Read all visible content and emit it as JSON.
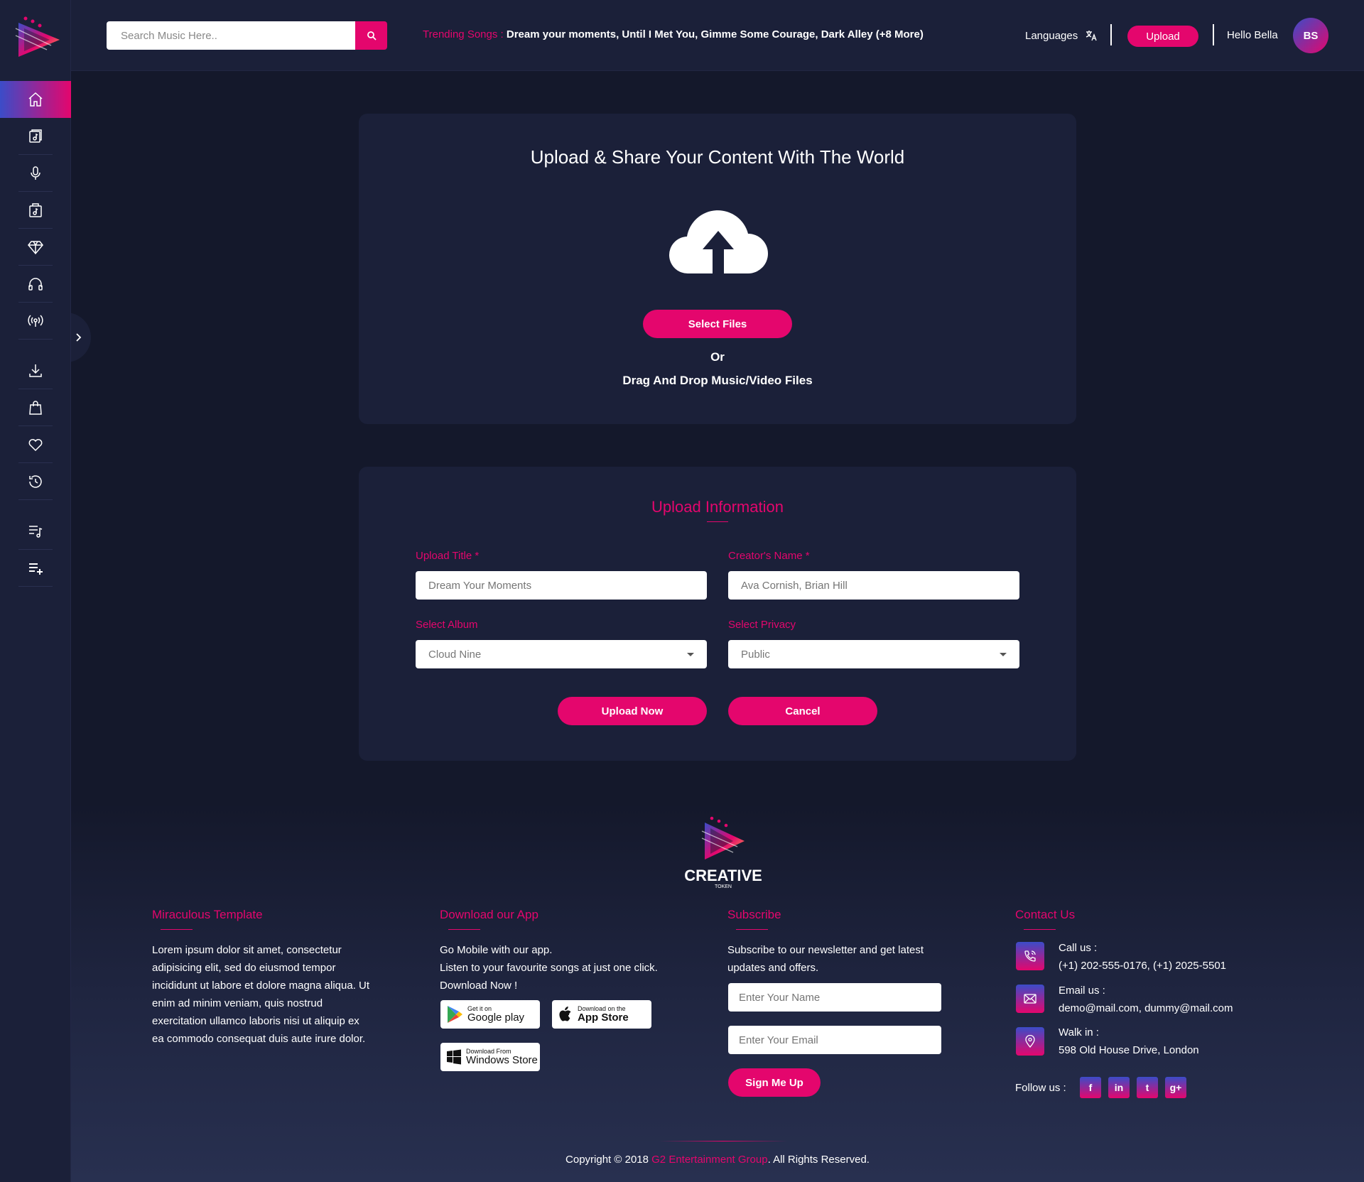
{
  "header": {
    "search_placeholder": "Search Music Here..",
    "trending_label": "Trending Songs :",
    "trending_songs": "Dream your moments, Until I Met You, Gimme Some Courage, Dark Alley (+8 More)",
    "languages_label": "Languages",
    "upload_label": "Upload",
    "greeting": "Hello Bella",
    "avatar_initials": "BS"
  },
  "sidebar": {
    "items": [
      "home-icon",
      "albums-icon",
      "microphone-icon",
      "music-folder-icon",
      "diamond-icon",
      "headphones-icon",
      "radio-icon",
      "download-icon",
      "bag-icon",
      "heart-icon",
      "history-icon",
      "playlist-icon",
      "add-playlist-icon"
    ]
  },
  "upload_card": {
    "title": "Upload & Share Your Content With The World",
    "select_files_label": "Select Files",
    "or_label": "Or",
    "drag_drop_label": "Drag And Drop Music/Video Files"
  },
  "upload_form": {
    "title": "Upload Information",
    "title_field_label": "Upload Title *",
    "title_field_placeholder": "Dream Your Moments",
    "creator_label": "Creator's Name *",
    "creator_placeholder": "Ava Cornish, Brian Hill",
    "album_label": "Select Album",
    "album_value": "Cloud Nine",
    "privacy_label": "Select Privacy",
    "privacy_value": "Public",
    "upload_now_label": "Upload Now",
    "cancel_label": "Cancel"
  },
  "footer": {
    "logo_text": "CREATIVE",
    "logo_subtext": "TOKEN",
    "col1_title": "Miraculous Template",
    "col1_text": "Lorem ipsum dolor sit amet, consectetur adipisicing elit, sed do eiusmod tempor incididunt ut labore et dolore magna aliqua. Ut enim ad minim veniam, quis nostrud exercitation ullamco laboris nisi ut aliquip ex ea commodo consequat duis aute irure dolor.",
    "col2_title": "Download our App",
    "col2_line1": "Go Mobile with our app.",
    "col2_line2": "Listen to your favourite songs at just one click. Download Now !",
    "google_small": "Get it on",
    "google_big": "Google play",
    "apple_small": "Download on the",
    "apple_big": "App Store",
    "windows_small": "Download From",
    "windows_big": "Windows Store",
    "col3_title": "Subscribe",
    "col3_text": "Subscribe to our newsletter and get latest updates and offers.",
    "name_placeholder": "Enter Your Name",
    "email_placeholder": "Enter Your Email",
    "signup_label": "Sign Me Up",
    "col4_title": "Contact Us",
    "call_label": "Call us :",
    "call_value": "(+1) 202-555-0176, (+1) 2025-5501",
    "email_label": "Email us :",
    "email_value": "demo@mail.com, dummy@mail.com",
    "walk_label": "Walk in :",
    "walk_value": "598 Old House Drive, London",
    "follow_label": "Follow us :",
    "social": [
      "f",
      "in",
      "t",
      "g+"
    ],
    "copyright_prefix": "Copyright © 2018 ",
    "copyright_brand": "G2 Entertainment Group",
    "copyright_suffix": ". All Rights Reserved."
  },
  "colors": {
    "accent": "#e4066d",
    "accent_blue": "#3b4cc8",
    "panel": "#1b2039",
    "background": "#14182b"
  }
}
